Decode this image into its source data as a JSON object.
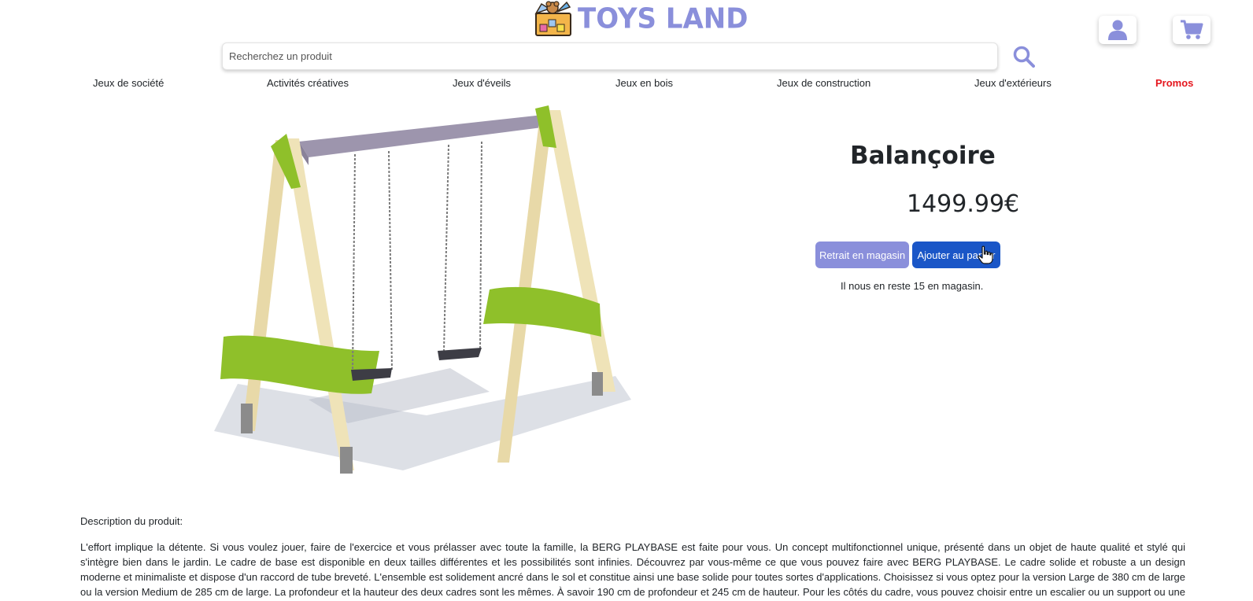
{
  "brand": {
    "name": "TOYS LAND",
    "logo_box_text": "TOYS",
    "colors": {
      "brand": "#8a8fdb",
      "primary": "#1a56c7",
      "promo": "#e5161e"
    }
  },
  "header": {
    "user_icon": "user-icon",
    "cart_icon": "cart-icon",
    "search_icon": "search-icon"
  },
  "search": {
    "placeholder": "Recherchez un produit",
    "value": ""
  },
  "nav": {
    "items": [
      "Jeux de société",
      "Activités créatives",
      "Jeux d'éveils",
      "Jeux en bois",
      "Jeux de construction",
      "Jeux d'extérieurs",
      "Promos"
    ]
  },
  "product": {
    "title": "Balançoire",
    "price": "1499.99€",
    "store_pickup_label": "Retrait en magasin",
    "add_to_cart_label": "Ajouter au panier",
    "stock_text": "Il nous en reste 15 en magasin.",
    "image_alt": "swing-set"
  },
  "description": {
    "label": "Description du produit:",
    "text": "L'effort implique la détente. Si vous voulez jouer, faire de l'exercice et vous prélasser avec toute la famille, la BERG PLAYBASE est faite pour vous. Un concept multifonctionnel unique, présenté dans un objet de haute qualité et stylé qui s'intègre bien dans le jardin. Le cadre de base est disponible en deux tailles différentes et les possibilités sont infinies. Découvrez par vous-même ce que vous pouvez faire avec BERG PLAYBASE. Le cadre solide et robuste a un design moderne et minimaliste et dispose d'un raccord de tube breveté. L'ensemble est solidement ancré dans le sol et constitue ainsi une base solide pour toutes sortes d'applications. Choisissez si vous optez pour la version Large de 380 cm de large ou la version Medium de 285 cm de large. La profondeur et la hauteur des deux cadres sont les mêmes. À savoir 190 cm de profondeur et 245 cm de hauteur. Pour les côtés du cadre, vous pouvez choisir entre un escalier ou un support ou une combinaison des deux. Savez-vous déjà ce que vous"
  }
}
